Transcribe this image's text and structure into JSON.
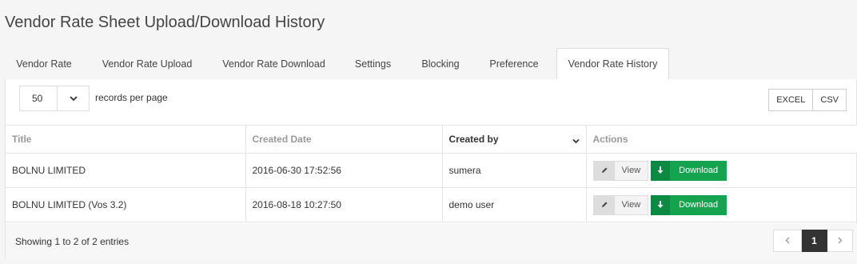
{
  "page": {
    "title": "Vendor Rate Sheet Upload/Download History"
  },
  "tabs": [
    {
      "label": "Vendor Rate"
    },
    {
      "label": "Vendor Rate Upload"
    },
    {
      "label": "Vendor Rate Download"
    },
    {
      "label": "Settings"
    },
    {
      "label": "Blocking"
    },
    {
      "label": "Preference"
    },
    {
      "label": "Vendor Rate History",
      "active": true
    }
  ],
  "length": {
    "value": "50",
    "label": "records per page"
  },
  "export": {
    "excel": "EXCEL",
    "csv": "CSV"
  },
  "table": {
    "columns": [
      "Title",
      "Created Date",
      "Created by",
      "Actions"
    ],
    "sorted_column": "Created by",
    "rows": [
      {
        "title": "BOLNU LIMITED",
        "created_date": "2016-06-30 17:52:56",
        "created_by": "sumera"
      },
      {
        "title": "BOLNU LIMITED (Vos 3.2)",
        "created_date": "2016-08-18 10:27:50",
        "created_by": "demo user"
      }
    ],
    "actions": {
      "view": "View",
      "download": "Download"
    }
  },
  "footer": {
    "info": "Showing 1 to 2 of 2 entries",
    "current_page": "1",
    "prev_icon": "chevron-left-icon",
    "next_icon": "chevron-right-icon"
  },
  "colors": {
    "download_green": "#14a34f",
    "download_green_dark": "#0c8a44",
    "active_page": "#333333"
  }
}
